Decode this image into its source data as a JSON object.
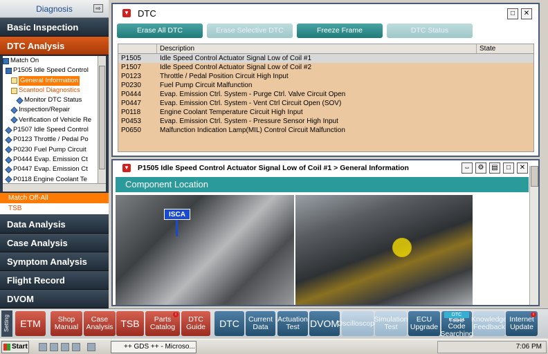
{
  "sidebar": {
    "diagnosis_label": "Diagnosis",
    "top_nav": [
      "Basic Inspection",
      "DTC Analysis"
    ],
    "tree": [
      {
        "label": "Match On",
        "icon": "book"
      },
      {
        "label": "P1505 Idle Speed Control",
        "icon": "book"
      },
      {
        "label": "General Information",
        "icon": "doc",
        "selected": true
      },
      {
        "label": "Scantool Diagnostics",
        "icon": "doc",
        "orange": true
      },
      {
        "label": "Monitor DTC Status",
        "icon": "diamond"
      },
      {
        "label": "Inspection/Repair",
        "icon": "diamond"
      },
      {
        "label": "Verification of Vehicle Re",
        "icon": "diamond"
      },
      {
        "label": "P1507 Idle Speed Control",
        "icon": "diamond"
      },
      {
        "label": "P0123 Throttle / Pedal Po",
        "icon": "diamond"
      },
      {
        "label": "P0230 Fuel Pump Circuit",
        "icon": "diamond"
      },
      {
        "label": "P0444 Evap. Emission Ct",
        "icon": "diamond"
      },
      {
        "label": "P0447 Evap. Emission Ct",
        "icon": "diamond"
      },
      {
        "label": "P0118 Engine Coolant Te",
        "icon": "diamond"
      }
    ],
    "match_off_label": "Match Off-All",
    "tsb_label": "TSB",
    "bottom_nav": [
      "Data Analysis",
      "Case Analysis",
      "Symptom Analysis",
      "Flight Record",
      "DVOM"
    ]
  },
  "dtc_panel": {
    "title": "DTC",
    "actions": [
      {
        "label": "Erase All DTC",
        "enabled": true
      },
      {
        "label": "Erase Selective DTC",
        "enabled": false
      },
      {
        "label": "Freeze Frame",
        "enabled": true
      },
      {
        "label": "DTC Status",
        "enabled": false
      }
    ],
    "columns": [
      "",
      "Description",
      "State"
    ],
    "rows": [
      {
        "code": "P1505",
        "description": "Idle Speed Control Actuator Signal Low of Coil #1",
        "state": ""
      },
      {
        "code": "P1507",
        "description": "Idle Speed Control Actuator Signal Low of Coil #2",
        "state": ""
      },
      {
        "code": "P0123",
        "description": "Throttle / Pedal Position Circuit High Input",
        "state": ""
      },
      {
        "code": "P0230",
        "description": "Fuel Pump Circuit Malfunction",
        "state": ""
      },
      {
        "code": "P0444",
        "description": "Evap. Emission Ctrl. System - Purge Ctrl. Valve Circuit Open",
        "state": ""
      },
      {
        "code": "P0447",
        "description": "Evap. Emission Ctrl. System - Vent Ctrl Circuit Open (SOV)",
        "state": ""
      },
      {
        "code": "P0118",
        "description": "Engine Coolant Temperature Circuit High Input",
        "state": ""
      },
      {
        "code": "P0453",
        "description": "Evap. Emission Ctrl. System - Pressure Sensor High Input",
        "state": ""
      },
      {
        "code": "P0650",
        "description": "Malfunction Indication Lamp(MIL) Control Circuit Malfunction",
        "state": ""
      }
    ]
  },
  "info_panel": {
    "title": "P1505 Idle Speed Control Actuator Signal Low of Coil #1 > General Information",
    "section_title": "Component Location",
    "isca_label": "ISCA"
  },
  "toolbar": {
    "setting_label": "Setting",
    "buttons": [
      {
        "label": "ETM",
        "style": "red",
        "big": true
      },
      {
        "label": "Shop Manual",
        "style": "red"
      },
      {
        "label": "Case Analysis",
        "style": "red"
      },
      {
        "label": "TSB",
        "style": "red",
        "big": true
      },
      {
        "label": "Parts Catalog",
        "style": "red",
        "badge": "i"
      },
      {
        "label": "DTC Guide",
        "style": "red"
      },
      {
        "label": "DTC",
        "style": "blue",
        "big": true
      },
      {
        "label": "Current Data",
        "style": "blue"
      },
      {
        "label": "Actuation Test",
        "style": "blue"
      },
      {
        "label": "DVOM",
        "style": "blue",
        "big": true
      },
      {
        "label": "Oscilloscope",
        "style": "lblue"
      },
      {
        "label": "Simulation Test",
        "style": "lblue"
      },
      {
        "label": "ECU Upgrade",
        "style": "blue"
      },
      {
        "label": "Fault Code Searching",
        "style": "blue",
        "found": "DTC Found"
      },
      {
        "label": "Knowledge Feedback",
        "style": "lblue"
      },
      {
        "label": "Internet Update",
        "style": "blue",
        "badge": "i"
      }
    ]
  },
  "taskbar": {
    "start_label": "Start",
    "task_label": "++ GDS ++ - Microso...",
    "clock": "7:06 PM"
  }
}
